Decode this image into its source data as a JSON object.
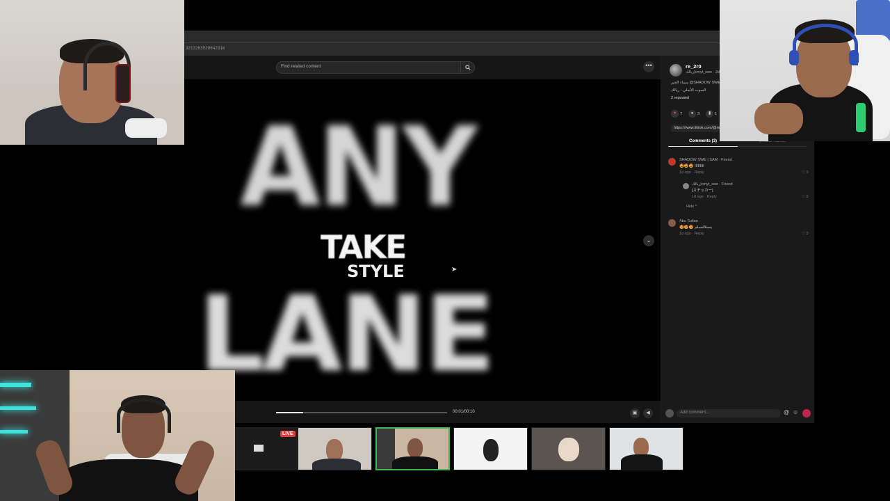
{
  "browser": {
    "url": "3212263528642316"
  },
  "search": {
    "placeholder": "Find related content"
  },
  "video": {
    "title_words": [
      "ANY",
      "TAKE",
      "STYLE",
      "LANE"
    ],
    "time": "00:01/00:10",
    "progress": 0.16
  },
  "post": {
    "author": "re_2r0",
    "author_sub": "ريالك|cmyt_swe · 2d",
    "desc_line1": "مساء الخير @SHADOW SWE",
    "desc_line2": "الصوت الأصلي - ريالك",
    "reposted": "2 reposted",
    "likes": "7",
    "comments_count": "3",
    "saves": "1",
    "link": "https://www.tiktok.com/@re_2r0/video"
  },
  "tabs": {
    "comments": "Comments (3)",
    "creator_videos": "Creator videos"
  },
  "comments": [
    {
      "name": "SHADOW SWE | SAM · Friend",
      "text": "🤩🤩🤩 ااااااااا",
      "time": "1d ago",
      "reply": "Reply",
      "likes": "1"
    },
    {
      "name": "ريالك|cmyt_swe · Friend",
      "text": "[ステッカー]",
      "time": "1d ago",
      "reply": "Reply",
      "likes": "2"
    },
    {
      "name": "Abu Sultan",
      "text": "🤩🤩🤩 يتسلالتسلم",
      "time": "1d ago",
      "reply": "Reply",
      "likes": "2"
    }
  ],
  "hide_label": "Hide ^",
  "comment_box": {
    "placeholder": "Add comment..."
  },
  "thumbs": {
    "live": "LIVE"
  },
  "colors": {
    "accent": "#c0254a",
    "selected_thumb": "#3cba54",
    "neon": "#3fe3dd"
  }
}
